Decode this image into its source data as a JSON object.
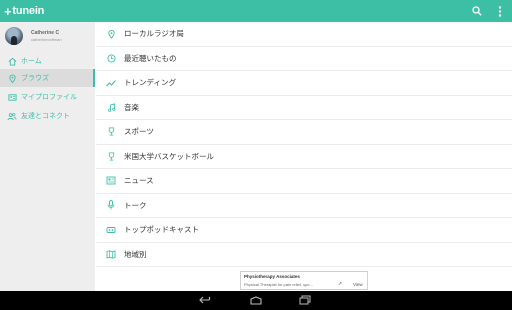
{
  "app": {
    "brand": "tunein"
  },
  "topbar": {
    "search_icon": "search-icon",
    "menu_icon": "overflow-menu-icon"
  },
  "profile": {
    "name": "Catherine C",
    "username": "catherinecoffman"
  },
  "sidebar": {
    "items": [
      {
        "label": "ホーム",
        "icon": "home-icon",
        "active": false
      },
      {
        "label": "ブラウズ",
        "icon": "location-pin-icon",
        "active": true
      },
      {
        "label": "マイプロファイル",
        "icon": "profile-card-icon",
        "active": false
      },
      {
        "label": "友達とコネクト",
        "icon": "people-icon",
        "active": false
      }
    ]
  },
  "browse": {
    "items": [
      {
        "label": "ローカルラジオ局",
        "icon": "location-pin-icon"
      },
      {
        "label": "最近聴いたもの",
        "icon": "clock-icon"
      },
      {
        "label": "トレンディング",
        "icon": "trending-icon"
      },
      {
        "label": "音楽",
        "icon": "music-note-icon"
      },
      {
        "label": "スポーツ",
        "icon": "trophy-icon"
      },
      {
        "label": "米国大学バスケットボール",
        "icon": "trophy-icon"
      },
      {
        "label": "ニュース",
        "icon": "newspaper-icon"
      },
      {
        "label": "トーク",
        "icon": "microphone-icon"
      },
      {
        "label": "トップポッドキャスト",
        "icon": "podcast-icon"
      },
      {
        "label": "地域別",
        "icon": "map-icon"
      }
    ]
  },
  "ad": {
    "title": "Physiotherapy Associates",
    "description": "Physical Therapist for pain relief, spo...",
    "cta": "View"
  },
  "navbar": {
    "back": "back-icon",
    "home": "home-nav-icon",
    "recents": "recents-icon"
  },
  "colors": {
    "accent": "#3dbfa6",
    "sidebar_bg": "#eeeeee",
    "navbar_bg": "#000000"
  }
}
